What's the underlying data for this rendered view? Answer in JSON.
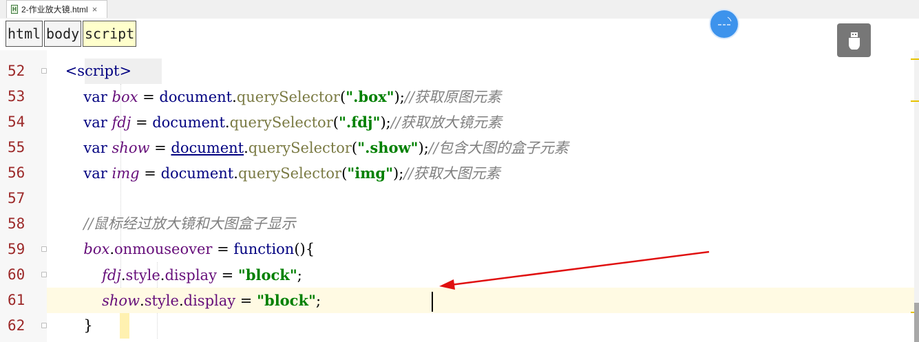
{
  "tab": {
    "title": "2-作业放大镜.html",
    "icon": "html-file-icon",
    "close": "×"
  },
  "breadcrumbs": [
    "html",
    "body",
    "script"
  ],
  "overlay_icons": [
    "translate-float-icon",
    "usb-drive-icon"
  ],
  "colors": {
    "keyword": "#000080",
    "variable": "#660e7a",
    "string": "#008000",
    "comment": "#808080",
    "method": "#7a7a43",
    "line_number": "#9c2929",
    "current_line": "#fffae3",
    "arrow": "#e01010"
  },
  "lines": [
    {
      "num": "52",
      "tokens": [
        {
          "t": "    "
        },
        {
          "t": "<script>",
          "c": "tag"
        }
      ]
    },
    {
      "num": "53",
      "tokens": [
        {
          "t": "        "
        },
        {
          "t": "var",
          "c": "kw"
        },
        {
          "t": " "
        },
        {
          "t": "box",
          "c": "var"
        },
        {
          "t": " = "
        },
        {
          "t": "document",
          "c": "obj"
        },
        {
          "t": "."
        },
        {
          "t": "querySelector",
          "c": "mth"
        },
        {
          "t": "("
        },
        {
          "t": "\".box\"",
          "c": "str"
        },
        {
          "t": ");"
        },
        {
          "t": "//获取原图元素",
          "c": "com"
        }
      ]
    },
    {
      "num": "54",
      "tokens": [
        {
          "t": "        "
        },
        {
          "t": "var",
          "c": "kw"
        },
        {
          "t": " "
        },
        {
          "t": "fdj",
          "c": "var"
        },
        {
          "t": " = "
        },
        {
          "t": "document",
          "c": "obj"
        },
        {
          "t": "."
        },
        {
          "t": "querySelector",
          "c": "mth"
        },
        {
          "t": "("
        },
        {
          "t": "\".fdj\"",
          "c": "str"
        },
        {
          "t": ");"
        },
        {
          "t": "//获取放大镜元素",
          "c": "com"
        }
      ]
    },
    {
      "num": "55",
      "tokens": [
        {
          "t": "        "
        },
        {
          "t": "var",
          "c": "kw"
        },
        {
          "t": " "
        },
        {
          "t": "show",
          "c": "var"
        },
        {
          "t": " = "
        },
        {
          "t": "document",
          "c": "obj u"
        },
        {
          "t": "."
        },
        {
          "t": "querySelector",
          "c": "mth"
        },
        {
          "t": "("
        },
        {
          "t": "\".show\"",
          "c": "str"
        },
        {
          "t": ");"
        },
        {
          "t": "//包含大图的盒子元素",
          "c": "com"
        }
      ]
    },
    {
      "num": "56",
      "tokens": [
        {
          "t": "        "
        },
        {
          "t": "var",
          "c": "kw"
        },
        {
          "t": " "
        },
        {
          "t": "img",
          "c": "var"
        },
        {
          "t": " = "
        },
        {
          "t": "document",
          "c": "obj"
        },
        {
          "t": "."
        },
        {
          "t": "querySelector",
          "c": "mth"
        },
        {
          "t": "("
        },
        {
          "t": "\"img\"",
          "c": "str"
        },
        {
          "t": ");"
        },
        {
          "t": "//获取大图元素",
          "c": "com"
        }
      ]
    },
    {
      "num": "57",
      "tokens": []
    },
    {
      "num": "58",
      "tokens": [
        {
          "t": "        "
        },
        {
          "t": "//鼠标经过放大镜和大图盒子显示",
          "c": "com"
        }
      ]
    },
    {
      "num": "59",
      "tokens": [
        {
          "t": "        "
        },
        {
          "t": "box",
          "c": "var"
        },
        {
          "t": "."
        },
        {
          "t": "onmouseover",
          "c": "prop"
        },
        {
          "t": " = "
        },
        {
          "t": "function",
          "c": "kw"
        },
        {
          "t": "(){"
        }
      ]
    },
    {
      "num": "60",
      "tokens": [
        {
          "t": "            "
        },
        {
          "t": "fdj",
          "c": "var"
        },
        {
          "t": "."
        },
        {
          "t": "style",
          "c": "prop"
        },
        {
          "t": "."
        },
        {
          "t": "display",
          "c": "prop"
        },
        {
          "t": " = "
        },
        {
          "t": "\"block\"",
          "c": "str"
        },
        {
          "t": ";"
        }
      ]
    },
    {
      "num": "61",
      "tokens": [
        {
          "t": "            "
        },
        {
          "t": "show",
          "c": "var"
        },
        {
          "t": "."
        },
        {
          "t": "style",
          "c": "prop"
        },
        {
          "t": "."
        },
        {
          "t": "display",
          "c": "prop"
        },
        {
          "t": " = "
        },
        {
          "t": "\"block\"",
          "c": "str"
        },
        {
          "t": ";"
        }
      ]
    },
    {
      "num": "62",
      "tokens": [
        {
          "t": "        "
        },
        {
          "t": "}"
        }
      ]
    }
  ]
}
